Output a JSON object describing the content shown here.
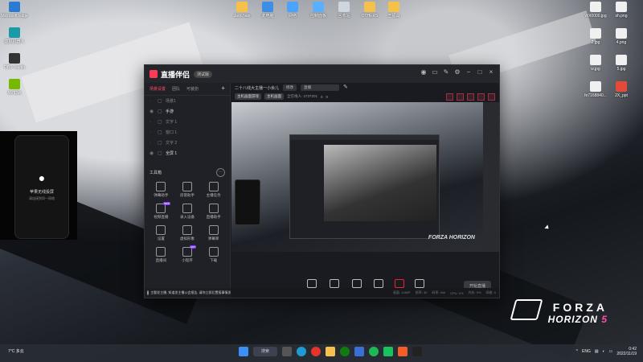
{
  "desktop": {
    "left_icons": [
      {
        "label": "Microsoft Edge",
        "color": "#2a7bd1"
      },
      {
        "label": "虚拟机器人",
        "color": "#1a9aa6"
      },
      {
        "label": "OBS Studio",
        "color": "#333"
      },
      {
        "label": "NVIDIA",
        "color": "#76b900"
      }
    ],
    "top_icons": [
      {
        "label": "Jack Nan",
        "color": "#f6c14a"
      },
      {
        "label": "此电脑",
        "color": "#3d8fe6"
      },
      {
        "label": "网络",
        "color": "#4aa3ff"
      },
      {
        "label": "控制面板",
        "color": "#5ab0ff"
      },
      {
        "label": "回收站",
        "color": "#cfd6df"
      },
      {
        "label": "OTHERS",
        "color": "#f6c14a"
      },
      {
        "label": "王福山",
        "color": "#f6c14a"
      }
    ],
    "right_icons": [
      {
        "label": "WX0000.jpg",
        "color": "#f0f0f0"
      },
      {
        "label": "sh.png",
        "color": "#f0f0f0"
      },
      {
        "label": "2.jpg",
        "color": "#f0f0f0"
      },
      {
        "label": "4.png",
        "color": "#f0f0f0"
      },
      {
        "label": "w.jpg",
        "color": "#f0f0f0"
      },
      {
        "label": "5.jpg",
        "color": "#f0f0f0"
      },
      {
        "label": "fe7168840...",
        "color": "#f0f0f0"
      },
      {
        "label": "2X_ppt",
        "color": "#e34a3a"
      }
    ]
  },
  "phone_panel": {
    "title": "苹果无线投屏",
    "subtitle": "请连接到同一网络"
  },
  "app": {
    "logo": "直播伴侣",
    "version": "测试版",
    "tabs": [
      "场景设置",
      "团队",
      "可装扮"
    ],
    "layers": [
      {
        "name": "场景1",
        "on": false
      },
      {
        "name": "手游",
        "on": true
      },
      {
        "name": "文字 1",
        "on": false
      },
      {
        "name": "窗口 1",
        "on": false
      },
      {
        "name": "文字 2",
        "on": false
      },
      {
        "name": "全屏 1",
        "on": true
      }
    ],
    "tools_header": "工具箱",
    "tools": [
      {
        "label": "弹幕助手",
        "badge": ""
      },
      {
        "label": "房管助手",
        "badge": ""
      },
      {
        "label": "主播任务",
        "badge": ""
      },
      {
        "label": "视频直播",
        "badge": "NEW"
      },
      {
        "label": "录入设备",
        "badge": ""
      },
      {
        "label": "直播助手",
        "badge": ""
      },
      {
        "label": "设置",
        "badge": ""
      },
      {
        "label": "虚拟形象",
        "badge": ""
      },
      {
        "label": "弹幕库",
        "badge": ""
      },
      {
        "label": "直播间",
        "badge": ""
      },
      {
        "label": "小程序",
        "badge": "HOT"
      },
      {
        "label": "下载",
        "badge": ""
      }
    ],
    "scene_title": "二十八线大主播一小余儿",
    "scene_button": "修改",
    "scene_dropdown": "直播",
    "source_mode": "主机画面游戏",
    "source_mode2": "主机画面",
    "source_stats": [
      "全在线人: 2737201",
      "0",
      "0"
    ],
    "preview_watermark": "FORZA HORIZON",
    "bottom_buttons": [
      "直播画面",
      "摄像头",
      "手机投屏",
      "多媒体",
      "麦克风",
      "扬声器"
    ],
    "start_button": "开始直播",
    "notice": "主题发主播, 知道发主播公会报告, 请你立即后置报事情发展",
    "status_items": [
      "画面: 1080P",
      "帧率: 30",
      "码率: 0kb",
      "CPU: 0%",
      "内存: 0%",
      "网络: 0"
    ]
  },
  "forza": {
    "line1": "FORZA",
    "line2": "HORIZON",
    "num": "5"
  },
  "taskbar": {
    "weather": "7°C 多云",
    "search": "搜索",
    "lang": "ENG",
    "time": "0:42",
    "date": "2022/11/19"
  }
}
